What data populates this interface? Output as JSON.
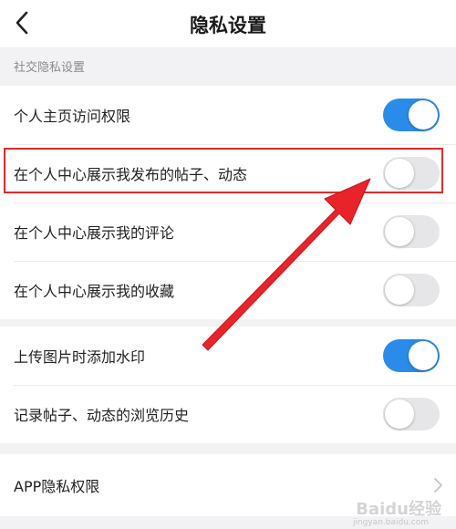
{
  "header": {
    "title": "隐私设置",
    "back_icon": "chevron-left-icon"
  },
  "section": {
    "label": "社交隐私设置"
  },
  "group1": {
    "rows": [
      {
        "label": "个人主页访问权限",
        "toggle_on": true
      },
      {
        "label": "在个人中心展示我发布的帖子、动态",
        "toggle_on": false
      },
      {
        "label": "在个人中心展示我的评论",
        "toggle_on": false
      },
      {
        "label": "在个人中心展示我的收藏",
        "toggle_on": false
      }
    ]
  },
  "group2": {
    "rows": [
      {
        "label": "上传图片时添加水印",
        "toggle_on": true
      },
      {
        "label": "记录帖子、动态的浏览历史",
        "toggle_on": false
      }
    ]
  },
  "group3": {
    "rows": [
      {
        "label": "APP隐私权限",
        "chevron_icon": "chevron-right-icon"
      }
    ]
  },
  "annotation": {
    "highlight_color": "#e12b2b",
    "arrow_color": "#e8242a"
  },
  "watermark": {
    "text": "Baidu经验",
    "sub": "jingyan.baidu.com"
  },
  "colors": {
    "toggle_on": "#2b8be8",
    "toggle_off": "#e6e6e8",
    "background": "#f2f2f4"
  }
}
